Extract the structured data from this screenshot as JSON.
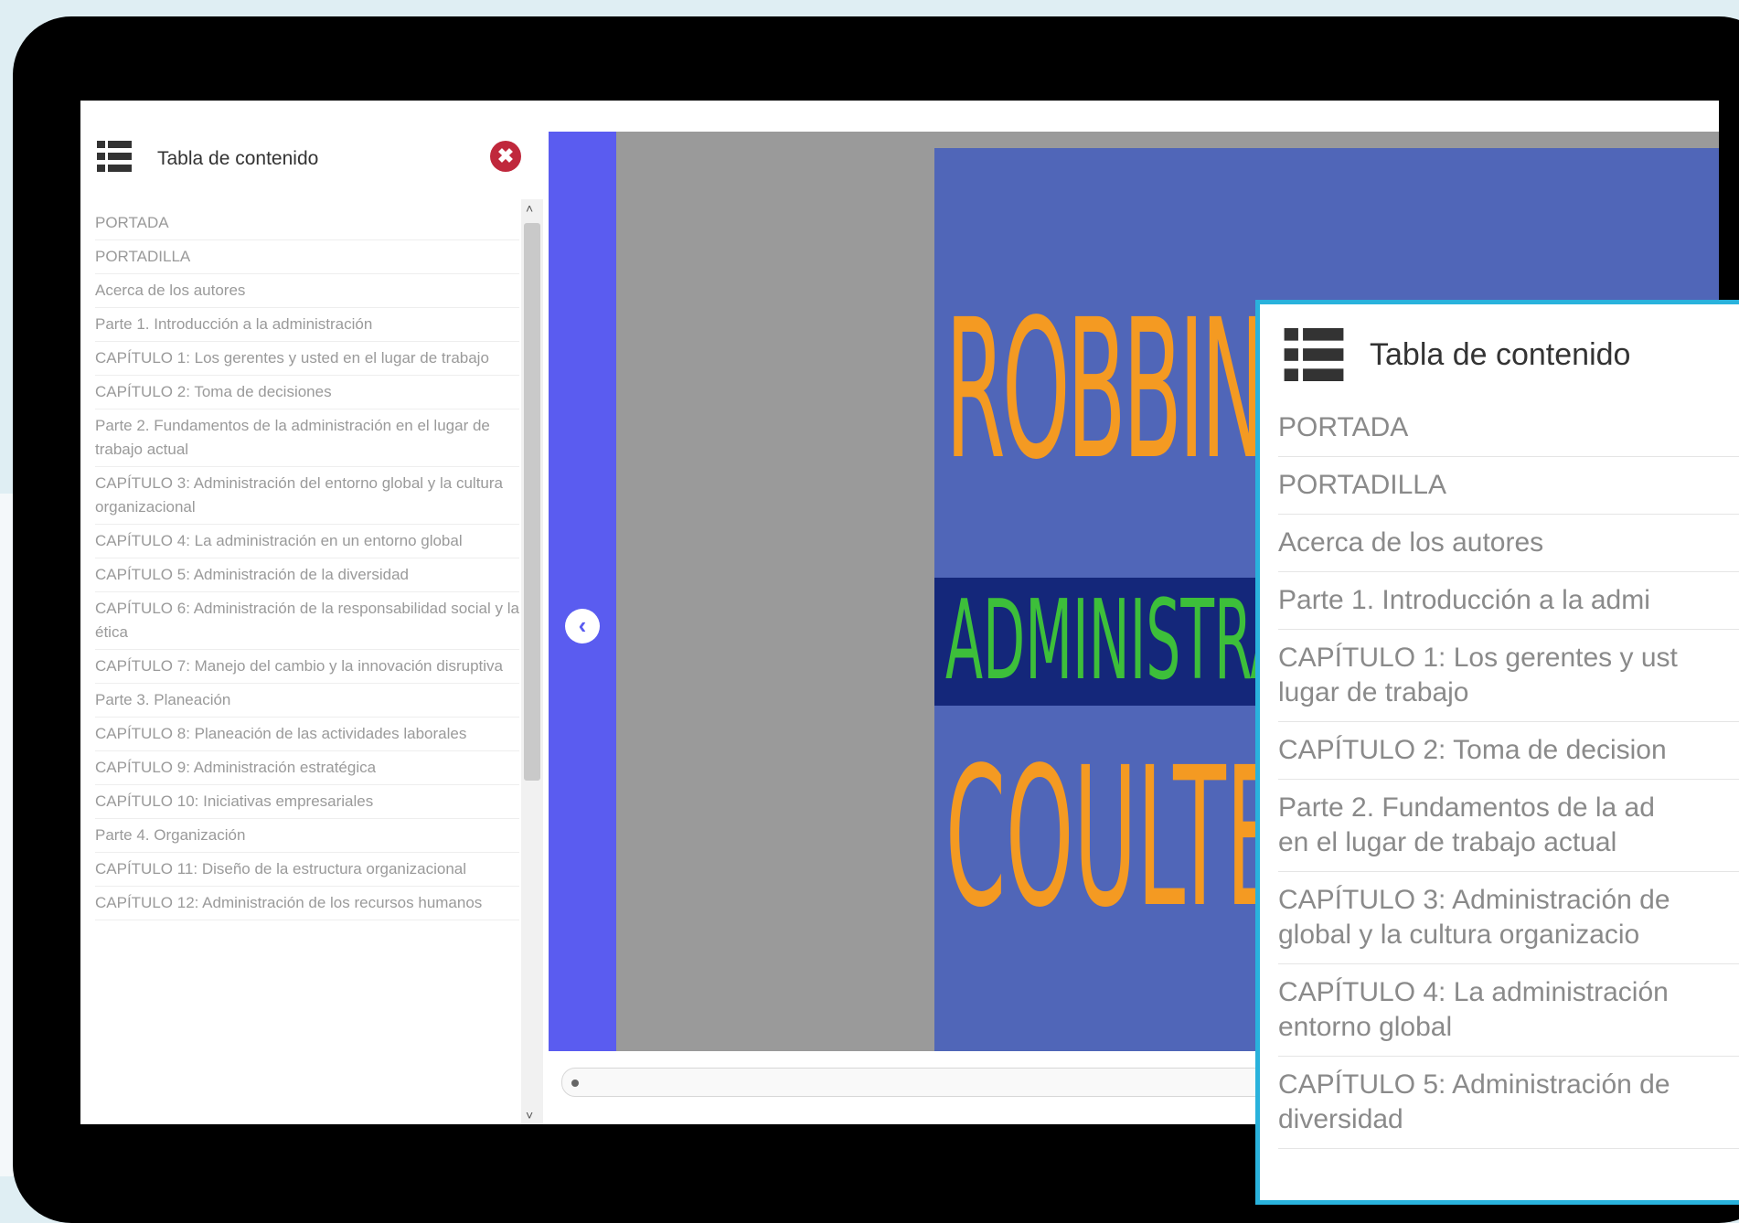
{
  "sidebar": {
    "title": "Tabla de contenido",
    "close_symbol": "✖",
    "items": [
      "PORTADA",
      "PORTADILLA",
      "Acerca de los autores",
      "Parte 1. Introducción a la administración",
      "CAPÍTULO 1: Los gerentes y usted en el lugar de trabajo",
      "CAPÍTULO 2: Toma de decisiones",
      "Parte 2. Fundamentos de la administración en el lugar de trabajo actual",
      "CAPÍTULO 3: Administración del entorno global y la cultura organizacional",
      "CAPÍTULO 4: La administración en un entorno global",
      "CAPÍTULO 5: Administración de la diversidad",
      "CAPÍTULO 6: Administración de la responsabilidad social y la ética",
      "CAPÍTULO 7: Manejo del cambio y la innovación disruptiva",
      "Parte 3. Planeación",
      "CAPÍTULO 8: Planeación de las actividades laborales",
      "CAPÍTULO 9: Administración estratégica",
      "CAPÍTULO 10: Iniciativas empresariales",
      "Parte 4. Organización",
      "CAPÍTULO 11: Diseño de la estructura organizacional",
      "CAPÍTULO 12: Administración de los recursos humanos"
    ]
  },
  "reader": {
    "prev_symbol": "‹",
    "cover_top": "ROBBINS",
    "cover_band": "ADMINISTRACIÓN",
    "cover_bottom": "COULTER"
  },
  "zoom": {
    "title": "Tabla de contenido",
    "items": [
      "PORTADA",
      "PORTADILLA",
      "Acerca de los autores",
      "Parte 1. Introducción a la admi",
      "CAPÍTULO 1: Los gerentes y ust\nlugar de trabajo",
      "CAPÍTULO 2: Toma de decision",
      "Parte 2. Fundamentos de la ad\nen el lugar de trabajo actual",
      "CAPÍTULO 3: Administración de\nglobal y la cultura organizacio",
      "CAPÍTULO 4: La administración\nentorno global",
      "CAPÍTULO 5: Administración de\ndiversidad"
    ]
  },
  "colors": {
    "frame": "#000000",
    "accent_blue": "#5a5cf0",
    "cover_blue": "#5066b8",
    "cover_orange": "#f49a22",
    "cover_green": "#3dbf3a",
    "zoom_border": "#29b2dc",
    "close_red": "#c0283c"
  },
  "icons": {
    "list": "list-icon",
    "close": "close-icon",
    "prev": "chevron-left-icon"
  }
}
